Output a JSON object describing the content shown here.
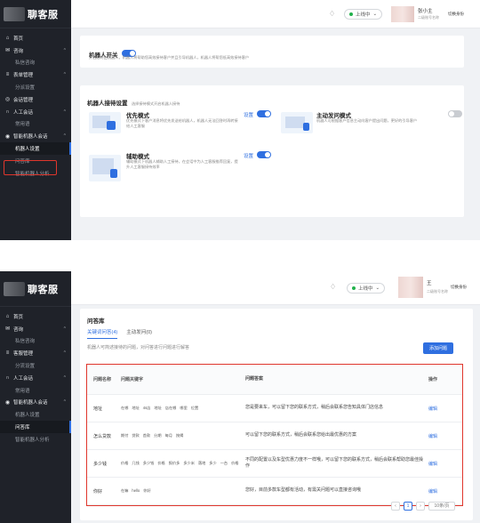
{
  "brand": {
    "title": "聊客服"
  },
  "screen1": {
    "sidebar": [
      {
        "label": "首页",
        "icon": "home-icon"
      },
      {
        "label": "咨询",
        "icon": "chat-icon",
        "caret": "^"
      },
      {
        "label": "私信咨询"
      },
      {
        "label": "表单管理",
        "icon": "form-icon",
        "caret": "^"
      },
      {
        "label": "分派设置"
      },
      {
        "label": "会话管理",
        "icon": "session-icon"
      },
      {
        "label": "人工会话",
        "icon": "headset-icon",
        "caret": "^"
      },
      {
        "label": "常用语"
      },
      {
        "label": "智能机器人会话",
        "icon": "robot-icon",
        "caret": "^"
      },
      {
        "label": "机器人设置"
      },
      {
        "label": "问答库"
      },
      {
        "label": "智能机器人分析"
      }
    ],
    "header": {
      "status": "上线中",
      "user_name": "张小主",
      "user_org": "二级账号名称",
      "identity": "切换身份"
    },
    "robot_switch": {
      "title": "机器人开关",
      "desc": "开启后将由机器人，机器人将帮助您高效接待客户并且引导机器人，机器人将帮您低高效接待客户"
    },
    "reception": {
      "title": "机器人接待设置",
      "subtitle": "选择接待模式开启机器人接待",
      "modes": [
        {
          "name": "优先模式",
          "desc": "优先模式下客户消息将优先发送给机器人，机器人无法回答时再转接给人工客服",
          "link": "设置",
          "on": true
        },
        {
          "name": "主动发问模式",
          "desc": "机器人可根据客户信息主动向客户提出问题，更好的引导客户",
          "link": "",
          "on": false
        },
        {
          "name": "辅助模式",
          "desc": "辅助模式下机器人辅助人工接待，在会话中为人工客服推荐回复，提升人工客服接待效率",
          "link": "设置",
          "on": true
        }
      ]
    }
  },
  "screen2": {
    "sidebar": [
      {
        "label": "首页",
        "icon": "home-icon"
      },
      {
        "label": "咨询",
        "icon": "chat-icon",
        "caret": "^"
      },
      {
        "label": "私信咨询"
      },
      {
        "label": "客服管理",
        "icon": "form-icon",
        "caret": "^"
      },
      {
        "label": "分流设置"
      },
      {
        "label": "人工会话",
        "icon": "headset-icon",
        "caret": "^"
      },
      {
        "label": "常用语"
      },
      {
        "label": "智能机器人会话",
        "icon": "robot-icon",
        "caret": "^"
      },
      {
        "label": "机器人设置"
      },
      {
        "label": "问答库"
      },
      {
        "label": "智能机器人分析"
      }
    ],
    "header": {
      "status": "上线中",
      "user_name": "王",
      "user_org": "二级账号名称",
      "identity": "切换身份"
    },
    "page_title": "问答库",
    "tabs": [
      "关键词问答(4)",
      "主动发问(0)"
    ],
    "hint": "机器人可简述接待的问题，对问答进行问题进行解答",
    "add_button": "添加问题",
    "table": {
      "headers": [
        "问题名称",
        "问题关键字",
        "问题答案",
        "操作"
      ],
      "rows": [
        {
          "name": "地址",
          "keywords": [
            "在哪",
            "地址",
            "4s店",
            "地址",
            "店在哪",
            "哪里",
            "位置"
          ],
          "answer": "您是要来车，可以留下您的联系方式，稍后会联系您告知具体门店信息",
          "action": "编辑"
        },
        {
          "name": "怎么贷款",
          "keywords": [
            "期付",
            "贷款",
            "首款",
            "分期",
            "每月",
            "按揭"
          ],
          "answer": "可以留下您的联系方式，稍后会联系您给出最优惠的方案",
          "action": "编辑"
        },
        {
          "name": "多少钱",
          "keywords": [
            "价格",
            "几钱",
            "多少钱",
            "价格",
            "报价多",
            "多少米",
            "落地",
            "多少",
            "一台",
            "价格"
          ],
          "answer": "不同的配置以及车型优惠力度不一样哦，可以留下您的联系方式，稍后会联系帮助您最佳操作",
          "action": "编辑"
        },
        {
          "name": "你好",
          "keywords": [
            "在嘛",
            "hello",
            "你好"
          ],
          "answer": "您好，目前多款车型都有活动，有需关问题可以直接咨询哦",
          "action": "编辑"
        }
      ]
    },
    "pagination": {
      "current": "1",
      "page_size": "10条/页"
    }
  }
}
